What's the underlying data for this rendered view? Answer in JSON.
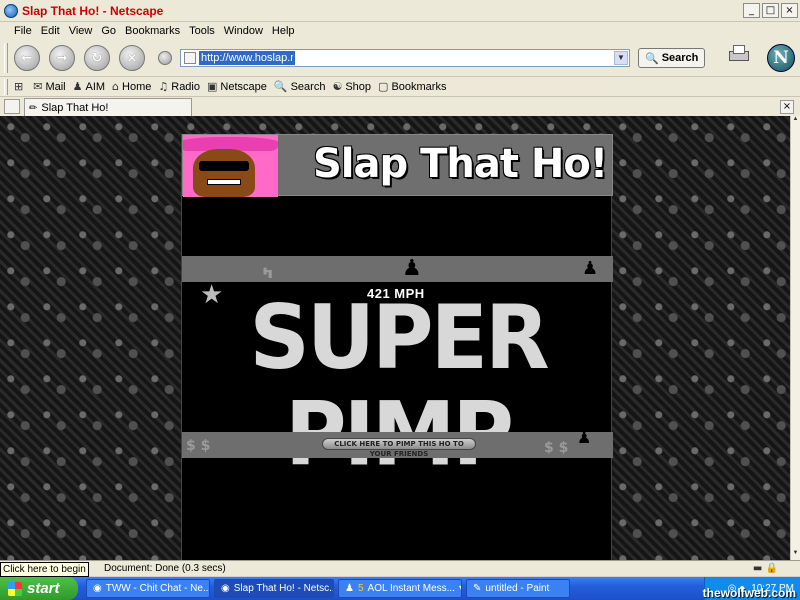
{
  "window": {
    "title": "Slap That Ho! - Netscape",
    "min": "_",
    "max": "□",
    "close": "×"
  },
  "menu": [
    "File",
    "Edit",
    "View",
    "Go",
    "Bookmarks",
    "Tools",
    "Window",
    "Help"
  ],
  "nav": {
    "url": "http://www.hoslap.net/",
    "search_label": "Search",
    "logo": "N"
  },
  "personal_toolbar": [
    "Mail",
    "AIM",
    "Home",
    "Radio",
    "Netscape",
    "Search",
    "Shop",
    "Bookmarks"
  ],
  "tab": {
    "label": "Slap That Ho!"
  },
  "page": {
    "site_title": "Slap That Ho!",
    "speed": "421 MPH",
    "rank": "SUPER PIMP",
    "share_button": "CLICK HERE TO PIMP THIS HO TO YOUR FRIENDS"
  },
  "status": {
    "text": "Document: Done (0.3 secs)",
    "tooltip": "Click here to begin"
  },
  "taskbar": {
    "start": "start",
    "tasks": [
      "TWW - Chit Chat - Ne...",
      "Slap That Ho! - Netsc...",
      "AOL Instant Mess...",
      "untitled - Paint"
    ],
    "aim_count": "5",
    "clock": "10:27 PM"
  },
  "watermark": "thewolfweb.com"
}
